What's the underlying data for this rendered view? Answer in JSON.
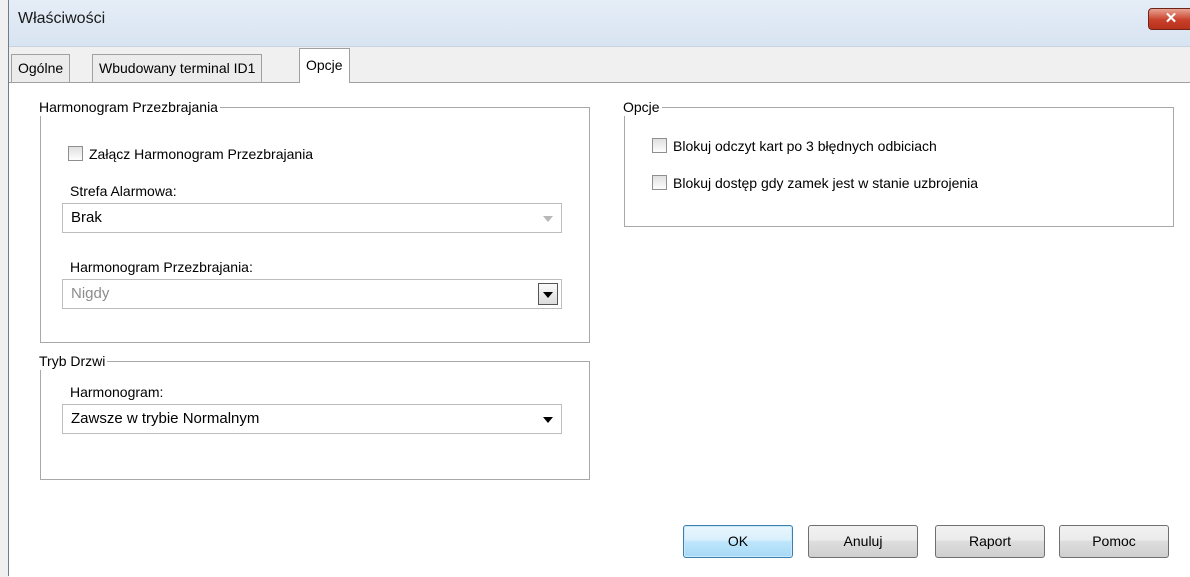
{
  "window": {
    "title": "Właściwości",
    "close_label": "✕"
  },
  "tabs": [
    {
      "label": "Ogólne",
      "active": false
    },
    {
      "label": "Wbudowany terminal ID1",
      "active": false
    },
    {
      "label": "Opcje",
      "active": true
    }
  ],
  "schedule_group": {
    "legend": "Harmonogram Przezbrajania",
    "enable_checkbox": {
      "label": "Załącz Harmonogram Przezbrajania",
      "checked": false
    },
    "zone_label": "Strefa Alarmowa:",
    "zone_value": "Brak",
    "schedule_label": "Harmonogram Przezbrajania:",
    "schedule_value": "Nigdy"
  },
  "door_group": {
    "legend": "Tryb Drzwi",
    "schedule_label": "Harmonogram:",
    "schedule_value": "Zawsze w trybie Normalnym"
  },
  "options_group": {
    "legend": "Opcje",
    "checkboxes": [
      {
        "label": "Blokuj odczyt kart po 3 błędnych odbiciach",
        "checked": false
      },
      {
        "label": "Blokuj dostęp gdy zamek jest w stanie uzbrojenia",
        "checked": false
      }
    ]
  },
  "buttons": {
    "ok": "OK",
    "cancel": "Anuluj",
    "report": "Raport",
    "help": "Pomoc"
  }
}
